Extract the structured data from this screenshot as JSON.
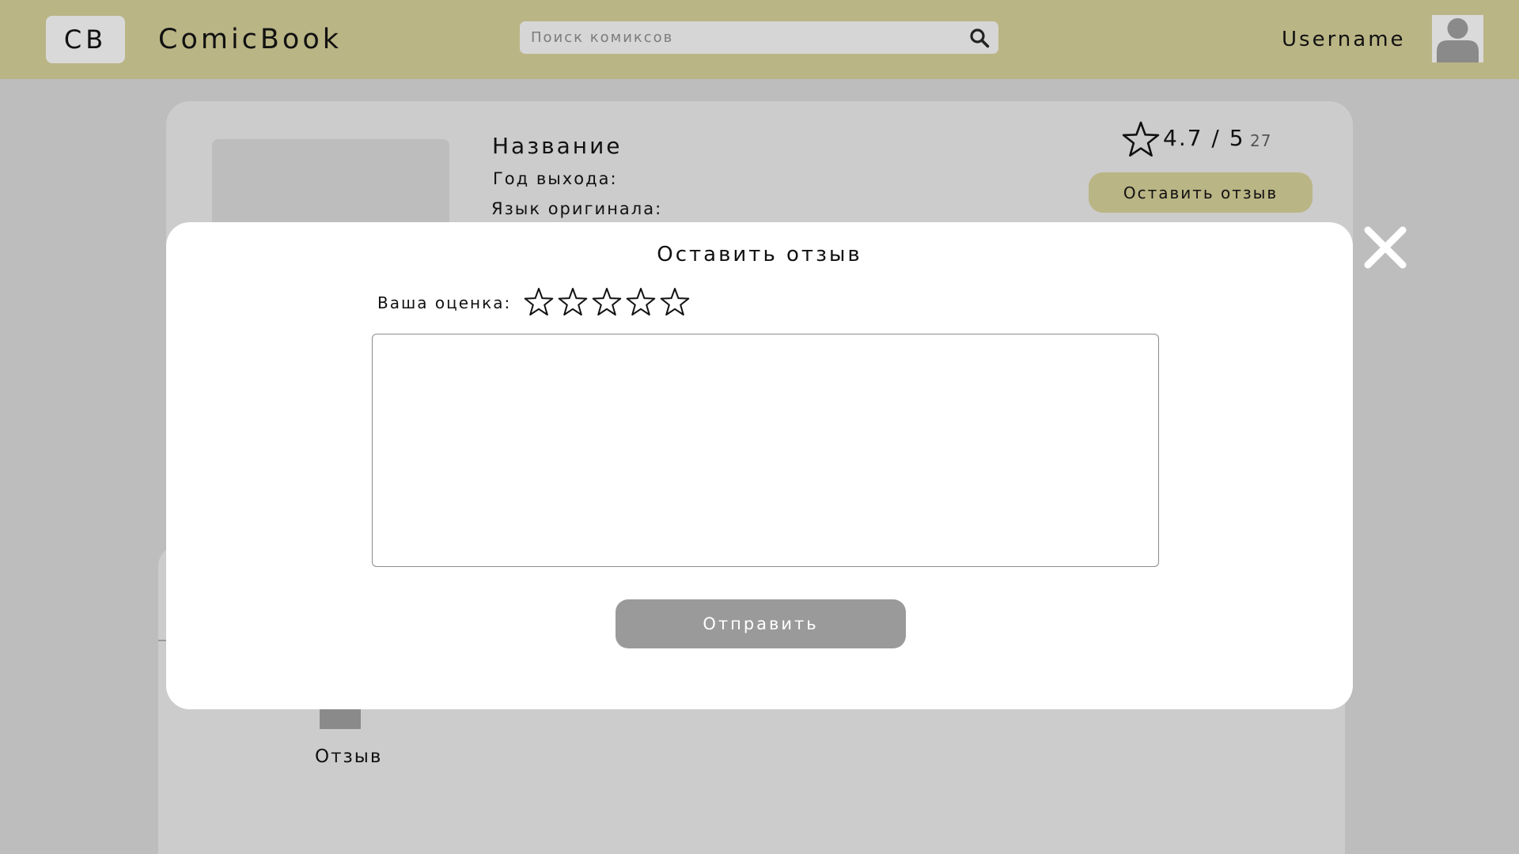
{
  "header": {
    "logo_badge": "CB",
    "brand": "ComicBook",
    "search_placeholder": "Поиск комиксов",
    "username": "Username"
  },
  "comic": {
    "title": "Название",
    "year_label": "Год выхода:",
    "language_label": "Язык оригинала:",
    "rating": "4.7 / 5",
    "rating_count": "27",
    "leave_review_button": "Оставить отзыв"
  },
  "reviews": {
    "item_label": "Отзыв"
  },
  "modal": {
    "title": "Оставить отзыв",
    "rating_label": "Ваша оценка:",
    "stars_total": 5,
    "stars_selected": 0,
    "review_text": "",
    "submit_button": "Отправить"
  },
  "colors": {
    "header_bg": "#bab585",
    "page_bg": "#bdbdbd",
    "card_bg": "#cccccc",
    "submit_bg": "#9a9a9a",
    "accent_button": "#bab585"
  },
  "icons": {
    "search": "search-icon",
    "avatar": "user-avatar-icon",
    "star": "star-outline-icon",
    "close": "close-icon"
  }
}
